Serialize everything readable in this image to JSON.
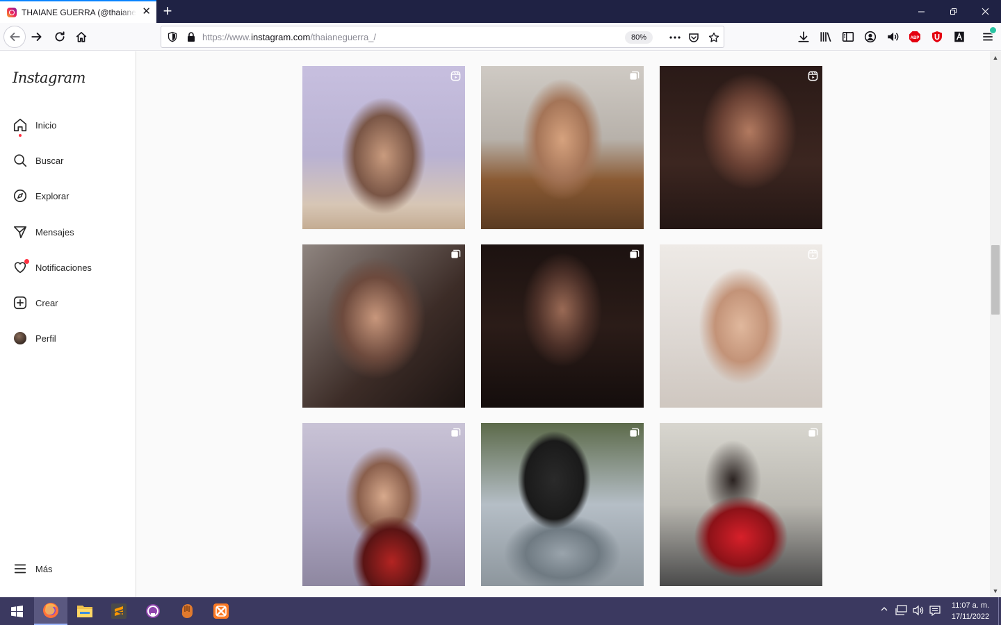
{
  "browser": {
    "tab_title": "THAIANE GUERRA (@thaianeguerra_) • Instagram",
    "url_prefix": "https://www.",
    "url_host": "instagram.com",
    "url_path": "/thaianeguerra_/",
    "zoom": "80%"
  },
  "app": {
    "logo": "Instagram",
    "nav": [
      {
        "label": "Inicio",
        "icon": "home-icon"
      },
      {
        "label": "Buscar",
        "icon": "search-icon"
      },
      {
        "label": "Explorar",
        "icon": "compass-icon"
      },
      {
        "label": "Mensajes",
        "icon": "messenger-icon"
      },
      {
        "label": "Notificaciones",
        "icon": "heart-icon"
      },
      {
        "label": "Crear",
        "icon": "plus-square-icon"
      },
      {
        "label": "Perfil",
        "icon": "avatar"
      }
    ],
    "more_label": "Más",
    "posts": [
      {
        "type": "reel"
      },
      {
        "type": "carousel"
      },
      {
        "type": "reel"
      },
      {
        "type": "carousel"
      },
      {
        "type": "carousel"
      },
      {
        "type": "reel"
      },
      {
        "type": "carousel"
      },
      {
        "type": "carousel"
      },
      {
        "type": "carousel"
      }
    ]
  },
  "taskbar": {
    "time": "11:07 a. m.",
    "date": "17/11/2022"
  }
}
